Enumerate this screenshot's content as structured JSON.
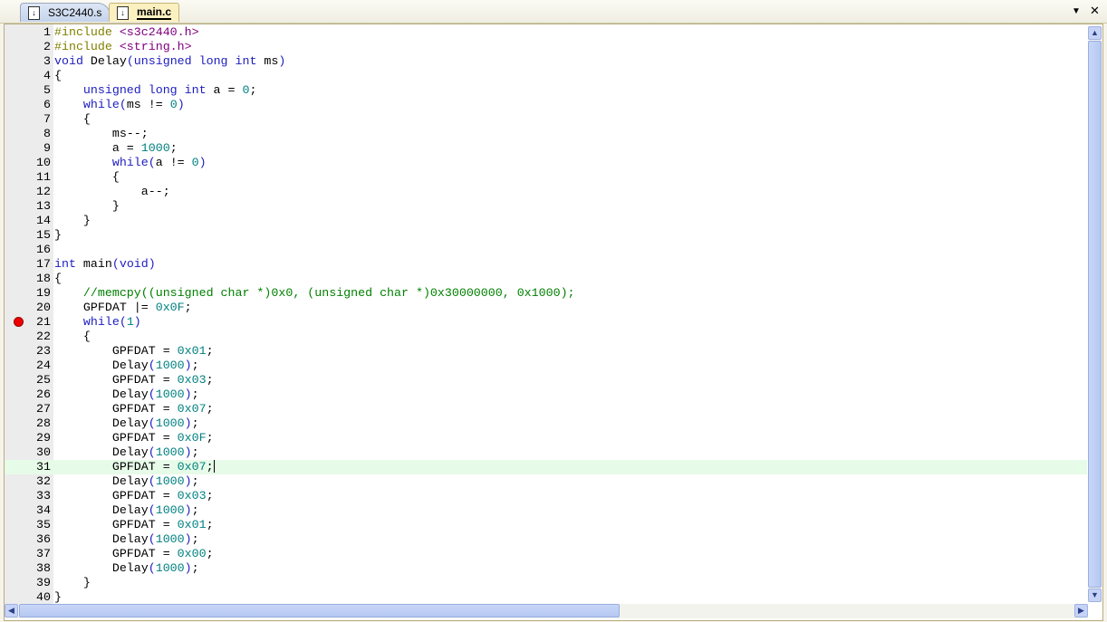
{
  "tabs": [
    {
      "label": "S3C2440.s",
      "active": false
    },
    {
      "label": "main.c",
      "active": true
    }
  ],
  "window_buttons": {
    "menu": "▼",
    "close": "✕"
  },
  "breakpoint_line": 21,
  "current_line": 31,
  "lines": [
    [
      [
        "p",
        "#include "
      ],
      [
        "s",
        "<s3c2440.h>"
      ]
    ],
    [
      [
        "p",
        "#include "
      ],
      [
        "s",
        "<string.h>"
      ]
    ],
    [
      [
        "k",
        "void"
      ],
      [
        "t",
        " Delay"
      ],
      [
        "o",
        "("
      ],
      [
        "k",
        "unsigned long int"
      ],
      [
        "t",
        " ms"
      ],
      [
        "o",
        ")"
      ]
    ],
    [
      [
        "t",
        "{"
      ]
    ],
    [
      [
        "t",
        "    "
      ],
      [
        "k",
        "unsigned long int"
      ],
      [
        "t",
        " a = "
      ],
      [
        "n",
        "0"
      ],
      [
        "t",
        ";"
      ]
    ],
    [
      [
        "t",
        "    "
      ],
      [
        "k",
        "while"
      ],
      [
        "o",
        "("
      ],
      [
        "t",
        "ms != "
      ],
      [
        "n",
        "0"
      ],
      [
        "o",
        ")"
      ]
    ],
    [
      [
        "t",
        "    {"
      ]
    ],
    [
      [
        "t",
        "        ms--;"
      ]
    ],
    [
      [
        "t",
        "        a = "
      ],
      [
        "n",
        "1000"
      ],
      [
        "t",
        ";"
      ]
    ],
    [
      [
        "t",
        "        "
      ],
      [
        "k",
        "while"
      ],
      [
        "o",
        "("
      ],
      [
        "t",
        "a != "
      ],
      [
        "n",
        "0"
      ],
      [
        "o",
        ")"
      ]
    ],
    [
      [
        "t",
        "        {"
      ]
    ],
    [
      [
        "t",
        "            a--;"
      ]
    ],
    [
      [
        "t",
        "        }"
      ]
    ],
    [
      [
        "t",
        "    }"
      ]
    ],
    [
      [
        "t",
        "}"
      ]
    ],
    [],
    [
      [
        "k",
        "int"
      ],
      [
        "t",
        " main"
      ],
      [
        "o",
        "("
      ],
      [
        "k",
        "void"
      ],
      [
        "o",
        ")"
      ]
    ],
    [
      [
        "t",
        "{"
      ]
    ],
    [
      [
        "t",
        "    "
      ],
      [
        "c",
        "//memcpy((unsigned char *)0x0, (unsigned char *)0x30000000, 0x1000);"
      ]
    ],
    [
      [
        "t",
        "    GPFDAT |= "
      ],
      [
        "n",
        "0x0F"
      ],
      [
        "t",
        ";"
      ]
    ],
    [
      [
        "t",
        "    "
      ],
      [
        "k",
        "while"
      ],
      [
        "o",
        "("
      ],
      [
        "n",
        "1"
      ],
      [
        "o",
        ")"
      ]
    ],
    [
      [
        "t",
        "    {"
      ]
    ],
    [
      [
        "t",
        "        GPFDAT = "
      ],
      [
        "n",
        "0x01"
      ],
      [
        "t",
        ";"
      ]
    ],
    [
      [
        "t",
        "        Delay"
      ],
      [
        "o",
        "("
      ],
      [
        "n",
        "1000"
      ],
      [
        "o",
        ")"
      ],
      [
        "t",
        ";"
      ]
    ],
    [
      [
        "t",
        "        GPFDAT = "
      ],
      [
        "n",
        "0x03"
      ],
      [
        "t",
        ";"
      ]
    ],
    [
      [
        "t",
        "        Delay"
      ],
      [
        "o",
        "("
      ],
      [
        "n",
        "1000"
      ],
      [
        "o",
        ")"
      ],
      [
        "t",
        ";"
      ]
    ],
    [
      [
        "t",
        "        GPFDAT = "
      ],
      [
        "n",
        "0x07"
      ],
      [
        "t",
        ";"
      ]
    ],
    [
      [
        "t",
        "        Delay"
      ],
      [
        "o",
        "("
      ],
      [
        "n",
        "1000"
      ],
      [
        "o",
        ")"
      ],
      [
        "t",
        ";"
      ]
    ],
    [
      [
        "t",
        "        GPFDAT = "
      ],
      [
        "n",
        "0x0F"
      ],
      [
        "t",
        ";"
      ]
    ],
    [
      [
        "t",
        "        Delay"
      ],
      [
        "o",
        "("
      ],
      [
        "n",
        "1000"
      ],
      [
        "o",
        ")"
      ],
      [
        "t",
        ";"
      ]
    ],
    [
      [
        "t",
        "        GPFDAT = "
      ],
      [
        "n",
        "0x07"
      ],
      [
        "t",
        ";"
      ]
    ],
    [
      [
        "t",
        "        Delay"
      ],
      [
        "o",
        "("
      ],
      [
        "n",
        "1000"
      ],
      [
        "o",
        ")"
      ],
      [
        "t",
        ";"
      ]
    ],
    [
      [
        "t",
        "        GPFDAT = "
      ],
      [
        "n",
        "0x03"
      ],
      [
        "t",
        ";"
      ]
    ],
    [
      [
        "t",
        "        Delay"
      ],
      [
        "o",
        "("
      ],
      [
        "n",
        "1000"
      ],
      [
        "o",
        ")"
      ],
      [
        "t",
        ";"
      ]
    ],
    [
      [
        "t",
        "        GPFDAT = "
      ],
      [
        "n",
        "0x01"
      ],
      [
        "t",
        ";"
      ]
    ],
    [
      [
        "t",
        "        Delay"
      ],
      [
        "o",
        "("
      ],
      [
        "n",
        "1000"
      ],
      [
        "o",
        ")"
      ],
      [
        "t",
        ";"
      ]
    ],
    [
      [
        "t",
        "        GPFDAT = "
      ],
      [
        "n",
        "0x00"
      ],
      [
        "t",
        ";"
      ]
    ],
    [
      [
        "t",
        "        Delay"
      ],
      [
        "o",
        "("
      ],
      [
        "n",
        "1000"
      ],
      [
        "o",
        ")"
      ],
      [
        "t",
        ";"
      ]
    ],
    [
      [
        "t",
        "    }"
      ]
    ],
    [
      [
        "t",
        "}"
      ]
    ]
  ]
}
